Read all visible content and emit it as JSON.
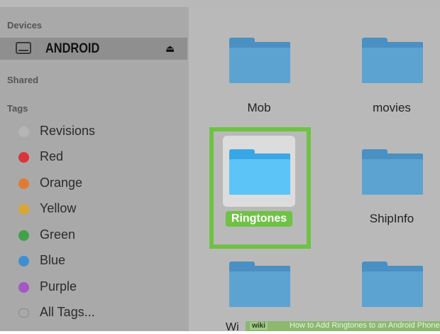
{
  "sidebar": {
    "devices_heading": "Devices",
    "device": {
      "name": "ANDROID",
      "icon": "drive-icon",
      "eject_icon": "eject-icon",
      "eject_glyph": "⏏"
    },
    "shared_heading": "Shared",
    "tags_heading": "Tags",
    "tags": [
      {
        "label": "Revisions",
        "color": "#b5b5b5"
      },
      {
        "label": "Red",
        "color": "#d8343b"
      },
      {
        "label": "Orange",
        "color": "#e07c31"
      },
      {
        "label": "Yellow",
        "color": "#d7a736"
      },
      {
        "label": "Green",
        "color": "#3ea347"
      },
      {
        "label": "Blue",
        "color": "#3e8fd1"
      },
      {
        "label": "Purple",
        "color": "#a457c7"
      },
      {
        "label": "All Tags...",
        "color": "#a9a9a9"
      }
    ]
  },
  "main": {
    "folders": [
      {
        "name": "Mob"
      },
      {
        "name": "movies"
      },
      {
        "name": "Ringtones",
        "selected": true
      },
      {
        "name": "ShipInfo"
      },
      {
        "name": "Wi"
      },
      {
        "name": ""
      }
    ]
  },
  "colors": {
    "selection": "#6fc244",
    "folder": "#4a90c2",
    "selected_folder": "#39a7e6"
  },
  "footer": {
    "logo": "wiki",
    "text": "How to Add Ringtones to an Android Phone"
  }
}
